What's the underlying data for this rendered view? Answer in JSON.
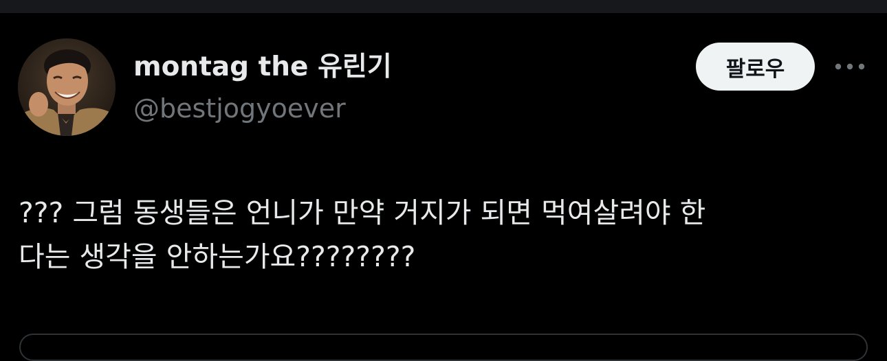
{
  "tweet": {
    "author": {
      "display_name": "montag the 유린기",
      "handle": "@bestjogyoever",
      "avatar_icon": "avatar-photo"
    },
    "follow_label": "팔로우",
    "more_icon": "more-horizontal-icon",
    "text_lines": [
      "??? 그럼 동생들은 언니가 만약 거지가 되면 먹여살려야 한",
      "다는 생각을 안하는가요????????"
    ]
  },
  "colors": {
    "background": "#000000",
    "primary_text": "#e7e9ea",
    "secondary_text": "#71767b",
    "follow_button_bg": "#eff3f4",
    "follow_button_text": "#0f1419"
  }
}
